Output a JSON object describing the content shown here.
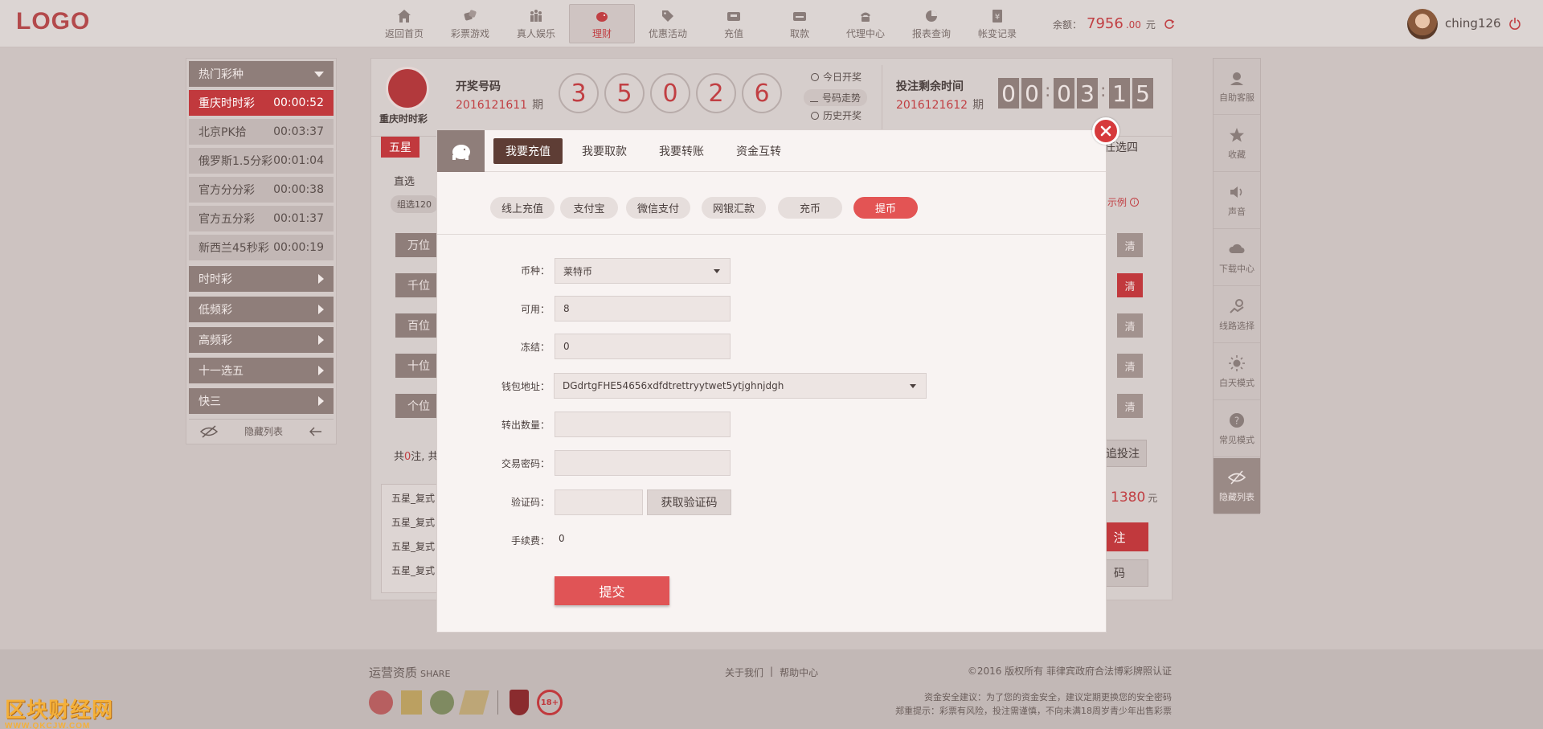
{
  "header": {
    "logo": "LOGO",
    "nav": [
      {
        "label": "返回首页",
        "icon": "home-icon"
      },
      {
        "label": "彩票游戏",
        "icon": "dice-icon"
      },
      {
        "label": "真人娱乐",
        "icon": "people-icon"
      },
      {
        "label": "理财",
        "icon": "piggy-bank-icon",
        "active": true
      },
      {
        "label": "优惠活动",
        "icon": "tag-icon"
      },
      {
        "label": "充值",
        "icon": "wallet-icon"
      },
      {
        "label": "取款",
        "icon": "withdraw-icon"
      },
      {
        "label": "代理中心",
        "icon": "phone-icon"
      },
      {
        "label": "报表查询",
        "icon": "pie-chart-icon"
      },
      {
        "label": "帐变记录",
        "icon": "yen-icon"
      }
    ],
    "balance_label": "余额：",
    "balance_int": "7956",
    "balance_dec": ".00",
    "balance_unit": "元",
    "username": "ching126"
  },
  "left_sidebar": {
    "hot_title": "热门彩种",
    "hot_items": [
      {
        "name": "重庆时时彩",
        "time": "00:00:52",
        "active": true
      },
      {
        "name": "北京PK拾",
        "time": "00:03:37"
      },
      {
        "name": "俄罗斯1.5分彩",
        "time": "00:01:04"
      },
      {
        "name": "官方分分彩",
        "time": "00:00:38"
      },
      {
        "name": "官方五分彩",
        "time": "00:01:37"
      },
      {
        "name": "新西兰45秒彩",
        "time": "00:00:19"
      }
    ],
    "categories": [
      "时时彩",
      "低频彩",
      "高频彩",
      "十一选五",
      "快三"
    ],
    "hide_label": "隐藏列表"
  },
  "lottery": {
    "name": "重庆时时彩",
    "draw_title": "开奖号码",
    "draw_period": "2016121611",
    "period_suffix": "期",
    "balls": [
      "3",
      "5",
      "0",
      "2",
      "6"
    ],
    "links": [
      "今日开奖",
      "号码走势",
      "历史开奖"
    ],
    "bet_title": "投注剩余时间",
    "bet_period": "2016121612",
    "countdown": [
      "0",
      "0",
      "0",
      "3",
      "1",
      "5"
    ],
    "play_tab": "五星",
    "play_tab_right": "任选四",
    "sub_label": "直选",
    "sub_tag": "组选120",
    "example": "示例",
    "positions": [
      "万位",
      "千位",
      "百位",
      "十位",
      "个位"
    ],
    "clear_label": "清",
    "total_prefix": "共",
    "total_count": "0",
    "total_suffix": "注, 共",
    "history_bet": "追投注",
    "amount": "1380",
    "amount_unit": "元",
    "bet_btn": "注",
    "code_btn": "码",
    "slip_rows": [
      "五星_复式",
      "五星_复式",
      "五星_复式",
      "五星_复式"
    ]
  },
  "right_sidebar": [
    {
      "label": "自助客服",
      "icon": "support-icon"
    },
    {
      "label": "收藏",
      "icon": "star-icon"
    },
    {
      "label": "声音",
      "icon": "speaker-icon"
    },
    {
      "label": "下载中心",
      "icon": "cloud-download-icon"
    },
    {
      "label": "线路选择",
      "icon": "route-icon"
    },
    {
      "label": "白天模式",
      "icon": "sun-icon"
    },
    {
      "label": "常见模式",
      "icon": "question-icon"
    },
    {
      "label": "隐藏列表",
      "icon": "eye-hidden-icon",
      "active": true
    }
  ],
  "footer": {
    "qual_title": "运营资质",
    "qual_sub": "SHARE",
    "links": [
      "关于我们",
      "帮助中心"
    ],
    "sep": "|",
    "copyright": "©2016 版权所有 菲律宾政府合法博彩牌照认证",
    "safety": "资金安全建议：为了您的资金安全，建议定期更换您的安全密码",
    "warning": "郑重提示：彩票有风险，投注需谨慎，不向未满18周岁青少年出售彩票",
    "age_badge": "18+"
  },
  "modal": {
    "tabs": [
      "我要充值",
      "我要取款",
      "我要转账",
      "资金互转"
    ],
    "pills": [
      "线上充值",
      "支付宝",
      "微信支付",
      "网银汇款",
      "充币",
      "提币"
    ],
    "fields": {
      "currency_label": "币种：",
      "currency_value": "莱特币",
      "available_label": "可用：",
      "available_value": "8",
      "frozen_label": "冻结：",
      "frozen_value": "0",
      "wallet_label": "钱包地址：",
      "wallet_value": "DGdrtgFHE54656xdfdtrettryytwet5ytjghnjdgh",
      "amount_label": "转出数量：",
      "password_label": "交易密码：",
      "captcha_label": "验证码：",
      "captcha_btn": "获取验证码",
      "fee_label": "手续费：",
      "fee_value": "0"
    },
    "submit": "提交"
  },
  "watermark": {
    "title": "区块财经网",
    "url": "WWW.QKCJW.COM"
  }
}
